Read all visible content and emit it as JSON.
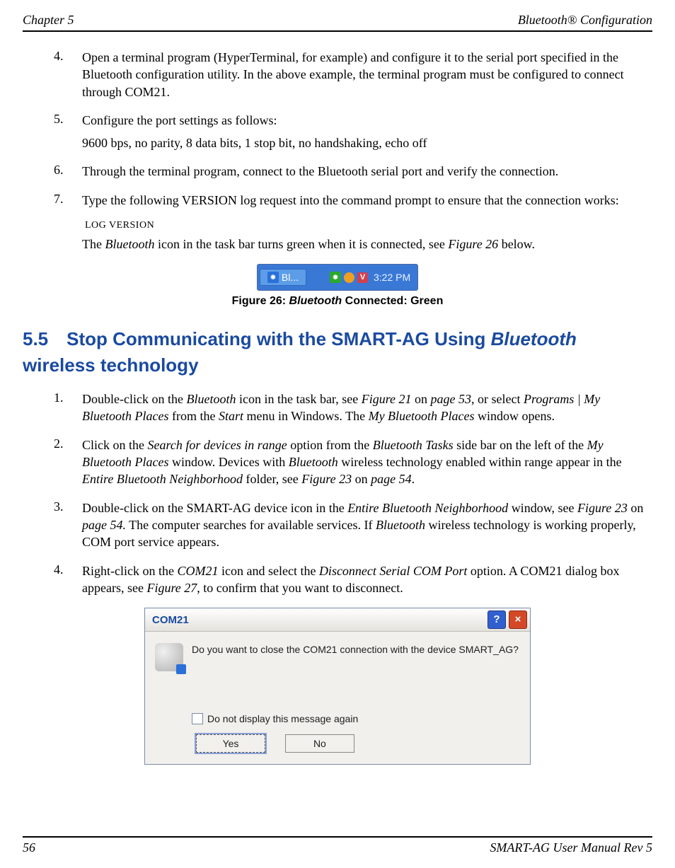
{
  "header": {
    "left": "Chapter 5",
    "right": "Bluetooth® Configuration"
  },
  "steps_a": [
    {
      "n": "4.",
      "text": "Open a terminal program (HyperTerminal, for example) and configure it to the serial port specified in the Bluetooth configuration utility. In the above example, the terminal program must be configured to connect through COM21."
    },
    {
      "n": "5.",
      "text": "Configure the port settings as follows:",
      "sub": "9600 bps, no parity, 8 data bits, 1 stop bit, no handshaking, echo off"
    },
    {
      "n": "6.",
      "text": "Through the terminal program, connect to the Bluetooth serial port and verify the connection."
    },
    {
      "n": "7.",
      "text": "Type the following VERSION log request into the command prompt to ensure that the connection works:"
    }
  ],
  "code": "LOG VERSION",
  "after_code_pre": "The ",
  "after_code_it1": "Bluetooth",
  "after_code_mid": " icon in the task bar turns green when it is connected, see ",
  "after_code_it2": "Figure 26",
  "after_code_post": " below.",
  "taskbar": {
    "btn": "Bl...",
    "time": "3:22 PM"
  },
  "fig26_pre": "Figure 26: ",
  "fig26_it": "Bluetooth",
  "fig26_post": " Connected: Green",
  "h2_num": "5.5",
  "h2_a": "Stop Communicating with the SMART-AG Using ",
  "h2_it": "Bluetooth",
  "h2_b": " wireless technology",
  "s1": {
    "n": "1.",
    "a": "Double-click on the ",
    "i1": "Bluetooth",
    "b": " icon in the task bar, see ",
    "i2": "Figure 21",
    "c": " on ",
    "i3": "page 53",
    "d": ", or select ",
    "i4": "Programs | My Bluetooth Places",
    "e": " from the ",
    "i5": "Start",
    "f": " menu in Windows. The ",
    "i6": "My Bluetooth Places",
    "g": " window opens."
  },
  "s2": {
    "n": "2.",
    "a": "Click on the ",
    "i1": "Search for devices in range",
    "b": " option from the ",
    "i2": "Bluetooth Tasks",
    "c": " side bar on the left of the ",
    "i3": "My Bluetooth Places",
    "d": " window. Devices with ",
    "i4": "Bluetooth",
    "e": " wireless technology enabled within range appear in the ",
    "i5": "Entire Bluetooth Neighborhood",
    "f": " folder, see ",
    "i6": "Figure 23",
    "g": " on ",
    "i7": "page 54",
    "h": "."
  },
  "s3": {
    "n": "3.",
    "a": "Double-click on the SMART-AG device icon in the ",
    "i1": "Entire Bluetooth Neighborhood",
    "b": " window, see ",
    "i2": "Figure 23",
    "c": " on ",
    "i3": "page 54.",
    "d": " The computer searches for available services. If ",
    "i4": "Bluetooth",
    "e": " wireless technology is working properly, COM port service appears."
  },
  "s4": {
    "n": "4.",
    "a": "Right-click on the ",
    "i1": "COM21",
    "b": " icon and select the ",
    "i2": "Disconnect Serial COM Port",
    "c": " option. A COM21 dialog box appears, see ",
    "i3": "Figure 27",
    "d": ", to confirm that you want to disconnect."
  },
  "dlg": {
    "title": "COM21",
    "msg": "Do you want to close the COM21 connection with the device SMART_AG?",
    "chk": "Do not display this message again",
    "yes": "Yes",
    "no": "No"
  },
  "footer": {
    "left": "56",
    "right": "SMART-AG User Manual Rev 5"
  }
}
